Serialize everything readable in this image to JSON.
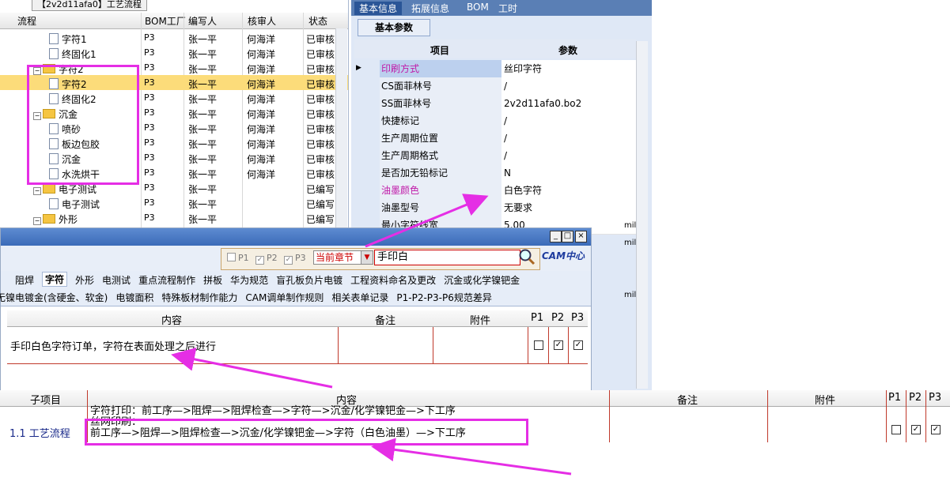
{
  "tree": {
    "title": "【2v2d11afa0】工艺流程",
    "columns": [
      "流程",
      "BOM工厂",
      "编写人",
      "核审人",
      "状态"
    ],
    "rows": [
      {
        "indent": 3,
        "type": "file",
        "name": "字符1",
        "bom": "P3",
        "author": "张一平",
        "reviewer": "何海洋",
        "status": "已审核"
      },
      {
        "indent": 3,
        "type": "file",
        "name": "终固化1",
        "bom": "P3",
        "author": "张一平",
        "reviewer": "何海洋",
        "status": "已审核"
      },
      {
        "indent": 2,
        "type": "folder",
        "name": "字符2",
        "bom": "P3",
        "author": "张一平",
        "reviewer": "何海洋",
        "status": "已审核"
      },
      {
        "indent": 3,
        "type": "file",
        "name": "字符2",
        "bom": "P3",
        "author": "张一平",
        "reviewer": "何海洋",
        "status": "已审核",
        "selected": true
      },
      {
        "indent": 3,
        "type": "file",
        "name": "终固化2",
        "bom": "P3",
        "author": "张一平",
        "reviewer": "何海洋",
        "status": "已审核"
      },
      {
        "indent": 2,
        "type": "folder",
        "name": "沉金",
        "bom": "P3",
        "author": "张一平",
        "reviewer": "何海洋",
        "status": "已审核"
      },
      {
        "indent": 3,
        "type": "file",
        "name": "喷砂",
        "bom": "P3",
        "author": "张一平",
        "reviewer": "何海洋",
        "status": "已审核"
      },
      {
        "indent": 3,
        "type": "file",
        "name": "板边包胶",
        "bom": "P3",
        "author": "张一平",
        "reviewer": "何海洋",
        "status": "已审核"
      },
      {
        "indent": 3,
        "type": "file",
        "name": "沉金",
        "bom": "P3",
        "author": "张一平",
        "reviewer": "何海洋",
        "status": "已审核"
      },
      {
        "indent": 3,
        "type": "file",
        "name": "水洗烘干",
        "bom": "P3",
        "author": "张一平",
        "reviewer": "何海洋",
        "status": "已审核"
      },
      {
        "indent": 2,
        "type": "folder",
        "name": "电子测试",
        "bom": "P3",
        "author": "张一平",
        "reviewer": "",
        "status": "已编写"
      },
      {
        "indent": 3,
        "type": "file",
        "name": "电子测试",
        "bom": "P3",
        "author": "张一平",
        "reviewer": "",
        "status": "已编写"
      },
      {
        "indent": 2,
        "type": "folder",
        "name": "外形",
        "bom": "P3",
        "author": "张一平",
        "reviewer": "",
        "status": "已编写"
      }
    ]
  },
  "props": {
    "tabs": [
      "基本信息",
      "拓展信息",
      "BOM",
      "工时"
    ],
    "subtab": "基本参数",
    "header": {
      "item": "项目",
      "param": "参数"
    },
    "rows": [
      {
        "k": "印刷方式",
        "v": "丝印字符",
        "pink": true,
        "current": true
      },
      {
        "k": "CS面菲林号",
        "v": "/"
      },
      {
        "k": "SS面菲林号",
        "v": "2v2d11afa0.bo2"
      },
      {
        "k": "快捷标记",
        "v": "/"
      },
      {
        "k": "生产周期位置",
        "v": "/"
      },
      {
        "k": "生产周期格式",
        "v": "/"
      },
      {
        "k": "是否加无铅标记",
        "v": "N"
      },
      {
        "k": "油墨颜色",
        "v": "白色字符",
        "pink": true
      },
      {
        "k": "油墨型号",
        "v": "无要求"
      },
      {
        "k": "最小字符线宽",
        "v": "5.00"
      }
    ],
    "side_units": [
      "mil",
      "mil",
      "mil"
    ]
  },
  "dialog": {
    "checks": [
      {
        "label": "P1",
        "checked": false
      },
      {
        "label": "P2",
        "checked": true
      },
      {
        "label": "P3",
        "checked": true
      }
    ],
    "chapter": "当前章节",
    "search_value": "手印白",
    "logo": "CAM中心",
    "tabs_row1": [
      "阻焊",
      "字符",
      "外形",
      "电测试",
      "重点流程制作",
      "拼板",
      "华为规范",
      "盲孔板负片电镀",
      "工程资料命名及更改",
      "沉金或化学镍钯金"
    ],
    "tabs_row2": [
      "无镍电镀金(含硬金、软金)",
      "电镀面积",
      "特殊板材制作能力",
      "CAM调单制作规则",
      "相关表单记录",
      "P1-P2-P3-P6规范差异"
    ],
    "columns": [
      "内容",
      "备注",
      "附件",
      "P1",
      "P2",
      "P3"
    ],
    "row": {
      "content": "手印白色字符订单，字符在表面处理之后进行",
      "p1": false,
      "p2": true,
      "p3": true
    }
  },
  "bottom": {
    "columns": [
      "子项目",
      "内容",
      "备注",
      "附件",
      "P1",
      "P2",
      "P3"
    ],
    "row": {
      "sub": "1.1 工艺流程",
      "line1": "字符打印：前工序—>阻焊—>阻焊检查—>字符—>沉金/化学镍钯金—>下工序",
      "line2": "丝网印刷：",
      "line3": "前工序—>阻焊—>阻焊检查—>沉金/化学镍钯金—>字符（白色油墨）—>下工序",
      "p1": false,
      "p2": true,
      "p3": true
    }
  },
  "colors": {
    "highlight": "#e52ee5",
    "selected": "#fcdc7a",
    "accent": "#2a5597"
  }
}
